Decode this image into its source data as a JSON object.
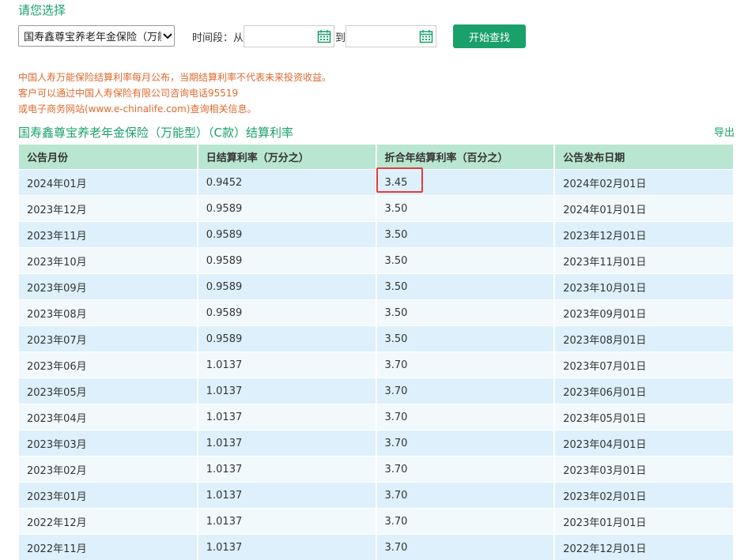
{
  "header": {
    "prompt_label": "请您选择",
    "product_select": "国寿鑫尊宝养老年金保险（万能型）",
    "time_label": "时间段：从",
    "to_label": "到",
    "date_from_value": "",
    "date_to_value": "",
    "search_button": "开始查找"
  },
  "notice": {
    "line1": "中国人寿万能保险结算利率每月公布，当期结算利率不代表未来投资收益。",
    "line2": "客户可以通过中国人寿保险有限公司咨询电话95519",
    "line3": "或电子商务网站(www.e-chinalife.com)查询相关信息。"
  },
  "table": {
    "title": "国寿鑫尊宝养老年金保险（万能型）（C款）结算利率",
    "export": "导出",
    "columns": [
      "公告月份",
      "日结算利率（万分之）",
      "折合年结算利率（百分之）",
      "公告发布日期"
    ],
    "rows": [
      [
        "2024年01月",
        "0.9452",
        "3.45",
        "2024年02月01日"
      ],
      [
        "2023年12月",
        "0.9589",
        "3.50",
        "2024年01月01日"
      ],
      [
        "2023年11月",
        "0.9589",
        "3.50",
        "2023年12月01日"
      ],
      [
        "2023年10月",
        "0.9589",
        "3.50",
        "2023年11月01日"
      ],
      [
        "2023年09月",
        "0.9589",
        "3.50",
        "2023年10月01日"
      ],
      [
        "2023年08月",
        "0.9589",
        "3.50",
        "2023年09月01日"
      ],
      [
        "2023年07月",
        "0.9589",
        "3.50",
        "2023年08月01日"
      ],
      [
        "2023年06月",
        "1.0137",
        "3.70",
        "2023年07月01日"
      ],
      [
        "2023年05月",
        "1.0137",
        "3.70",
        "2023年06月01日"
      ],
      [
        "2023年04月",
        "1.0137",
        "3.70",
        "2023年05月01日"
      ],
      [
        "2023年03月",
        "1.0137",
        "3.70",
        "2023年04月01日"
      ],
      [
        "2023年02月",
        "1.0137",
        "3.70",
        "2023年03月01日"
      ],
      [
        "2023年01月",
        "1.0137",
        "3.70",
        "2023年02月01日"
      ],
      [
        "2022年12月",
        "1.0137",
        "3.70",
        "2023年01月01日"
      ],
      [
        "2022年11月",
        "1.0137",
        "3.70",
        "2022年12月01日"
      ]
    ]
  },
  "colors": {
    "brand_green": "#1aa06b",
    "header_row": "#b9e6d0",
    "row_odd": "#ddf0fb",
    "row_even": "#f2f9fd",
    "notice_orange": "#e0692c",
    "highlight_red": "#e33b3b"
  },
  "icons": {
    "select_arrow": "chevron-down-icon",
    "date_picker": "calendar-icon"
  }
}
